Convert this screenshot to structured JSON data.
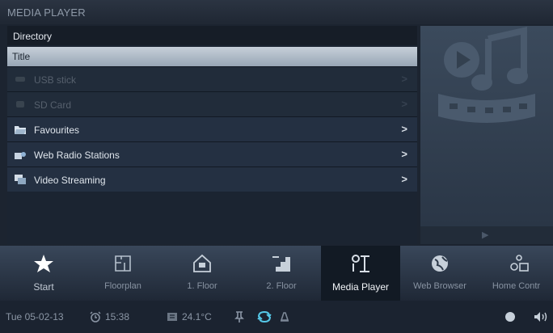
{
  "app": {
    "title": "MEDIA PLAYER"
  },
  "list": {
    "directory_label": "Directory",
    "column_title": "Title",
    "items": [
      {
        "label": "USB stick",
        "icon": "usb-icon",
        "enabled": false
      },
      {
        "label": "SD Card",
        "icon": "sd-card-icon",
        "enabled": false
      },
      {
        "label": "Favourites",
        "icon": "folder-icon",
        "enabled": true
      },
      {
        "label": "Web Radio Stations",
        "icon": "radio-icon",
        "enabled": true
      },
      {
        "label": "Video Streaming",
        "icon": "video-icon",
        "enabled": true
      }
    ],
    "chevron": ">"
  },
  "preview": {
    "icon": "media-artwork-icon",
    "play_glyph": "▶"
  },
  "dock": {
    "items": [
      {
        "label": "Start",
        "icon": "star-icon"
      },
      {
        "label": "Floorplan",
        "icon": "floorplan-icon"
      },
      {
        "label": "1. Floor",
        "icon": "floor-icon"
      },
      {
        "label": "2. Floor",
        "icon": "stairs-icon"
      },
      {
        "label": "Media Player",
        "icon": "media-player-icon",
        "active": true
      },
      {
        "label": "Web Browser",
        "icon": "globe-icon"
      },
      {
        "label": "Home Contr",
        "icon": "home-control-icon"
      }
    ]
  },
  "status": {
    "date": "Tue 05-02-13",
    "time": "15:38",
    "temperature": "24.1°C"
  },
  "colors": {
    "accent": "#56c8e8",
    "background": "#1c2430"
  }
}
